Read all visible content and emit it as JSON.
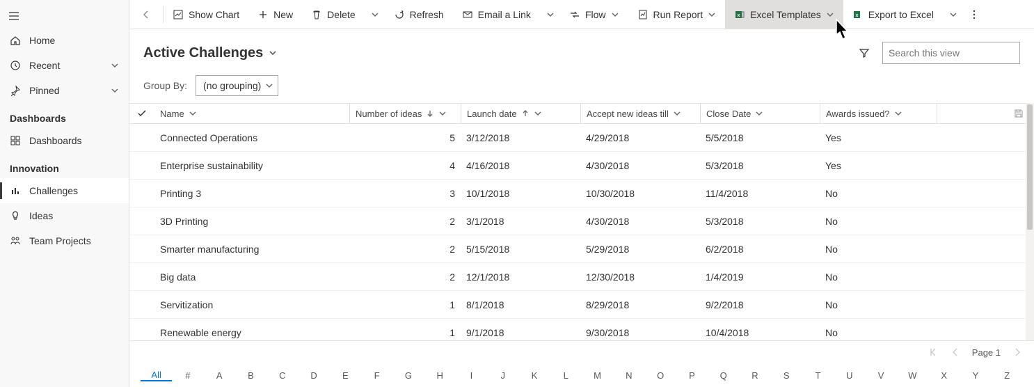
{
  "sidebar": {
    "home": "Home",
    "recent": "Recent",
    "pinned": "Pinned",
    "section_dash": "Dashboards",
    "dashboards": "Dashboards",
    "section_innov": "Innovation",
    "challenges": "Challenges",
    "ideas": "Ideas",
    "team_projects": "Team Projects"
  },
  "cmd": {
    "show_chart": "Show Chart",
    "new": "New",
    "delete": "Delete",
    "refresh": "Refresh",
    "email": "Email a Link",
    "flow": "Flow",
    "run_report": "Run Report",
    "excel_tpl": "Excel Templates",
    "export_excel": "Export to Excel"
  },
  "view": {
    "title": "Active Challenges",
    "group_by_label": "Group By:",
    "group_by_value": "(no grouping)",
    "search_placeholder": "Search this view"
  },
  "cols": {
    "name": "Name",
    "num_ideas": "Number of ideas",
    "launch": "Launch date",
    "accept": "Accept new ideas till",
    "close": "Close Date",
    "awards": "Awards issued?"
  },
  "rows": [
    {
      "name": "Connected Operations",
      "num": "5",
      "launch": "3/12/2018",
      "accept": "4/29/2018",
      "close": "5/5/2018",
      "awards": "Yes"
    },
    {
      "name": "Enterprise sustainability",
      "num": "4",
      "launch": "4/16/2018",
      "accept": "4/30/2018",
      "close": "5/3/2018",
      "awards": "Yes"
    },
    {
      "name": "Printing 3",
      "num": "3",
      "launch": "10/1/2018",
      "accept": "10/30/2018",
      "close": "11/4/2018",
      "awards": "No"
    },
    {
      "name": "3D Printing",
      "num": "2",
      "launch": "3/1/2018",
      "accept": "4/30/2018",
      "close": "5/3/2018",
      "awards": "No"
    },
    {
      "name": "Smarter manufacturing",
      "num": "2",
      "launch": "5/15/2018",
      "accept": "5/29/2018",
      "close": "6/2/2018",
      "awards": "No"
    },
    {
      "name": "Big data",
      "num": "2",
      "launch": "12/1/2018",
      "accept": "12/30/2018",
      "close": "1/4/2019",
      "awards": "No"
    },
    {
      "name": "Servitization",
      "num": "1",
      "launch": "8/1/2018",
      "accept": "8/29/2018",
      "close": "9/2/2018",
      "awards": "No"
    },
    {
      "name": "Renewable energy",
      "num": "1",
      "launch": "9/1/2018",
      "accept": "9/30/2018",
      "close": "10/4/2018",
      "awards": "No"
    }
  ],
  "pager": {
    "label": "Page 1"
  },
  "alpha": [
    "All",
    "#",
    "A",
    "B",
    "C",
    "D",
    "E",
    "F",
    "G",
    "H",
    "I",
    "J",
    "K",
    "L",
    "M",
    "N",
    "O",
    "P",
    "Q",
    "R",
    "S",
    "T",
    "U",
    "V",
    "W",
    "X",
    "Y",
    "Z"
  ]
}
